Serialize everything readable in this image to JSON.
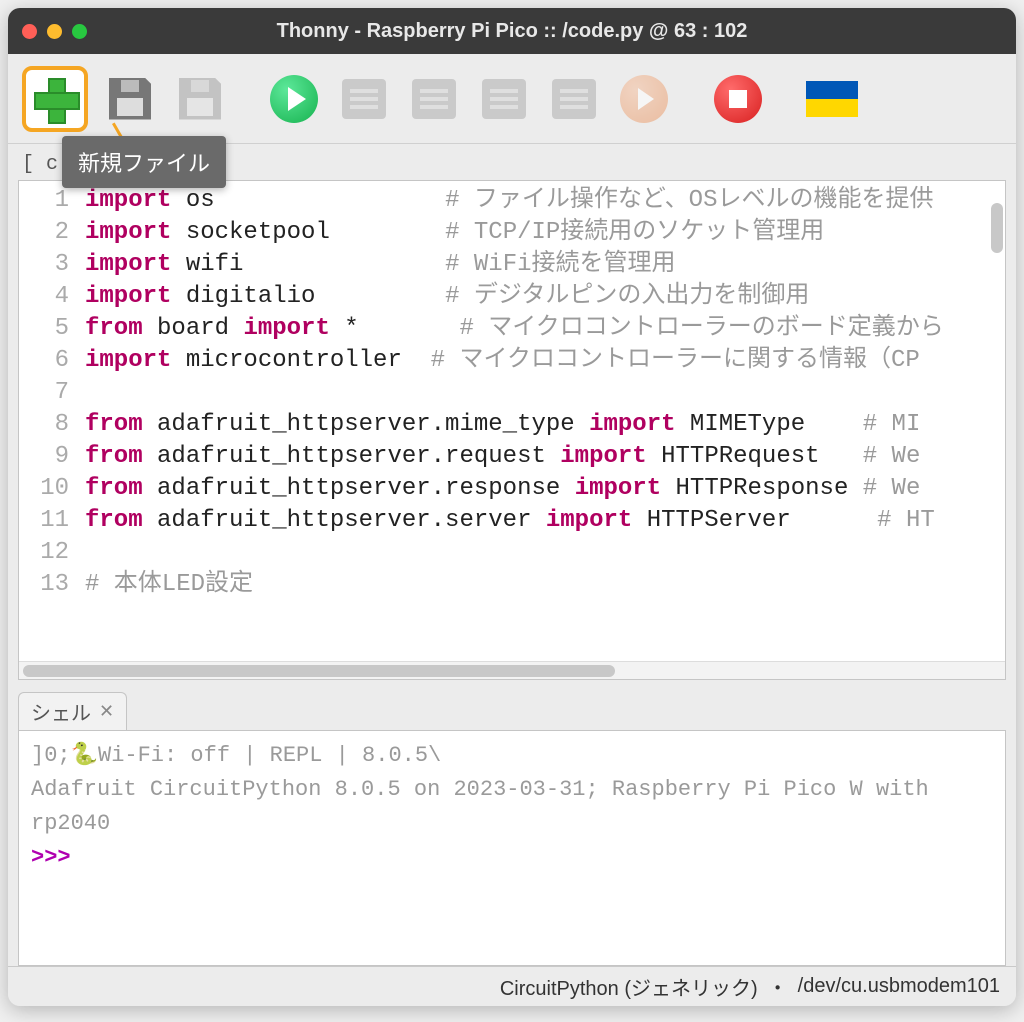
{
  "window": {
    "title": "Thonny  -  Raspberry Pi Pico :: /code.py  @  63 : 102"
  },
  "toolbar": {
    "tooltip_new_file": "新規ファイル"
  },
  "editor": {
    "tab_prefix": "[ c",
    "lines": [
      {
        "n": "1",
        "pre": "",
        "kw": "import",
        "mid": " os                ",
        "cm": "# ファイル操作など、OSレベルの機能を提供"
      },
      {
        "n": "2",
        "pre": "",
        "kw": "import",
        "mid": " socketpool        ",
        "cm": "# TCP/IP接続用のソケット管理用"
      },
      {
        "n": "3",
        "pre": "",
        "kw": "import",
        "mid": " wifi              ",
        "cm": "# WiFi接続を管理用"
      },
      {
        "n": "4",
        "pre": "",
        "kw": "import",
        "mid": " digitalio         ",
        "cm": "# デジタルピンの入出力を制御用"
      },
      {
        "n": "5",
        "pre": "",
        "kw": "from",
        "mid": " board ",
        "kw2": "import",
        "tail": " *       ",
        "cm": "# マイクロコントローラーのボード定義から"
      },
      {
        "n": "6",
        "pre": "",
        "kw": "import",
        "mid": " microcontroller  ",
        "cm": "# マイクロコントローラーに関する情報（CP"
      },
      {
        "n": "7",
        "pre": "",
        "kw": "",
        "mid": "",
        "cm": ""
      },
      {
        "n": "8",
        "pre": "",
        "kw": "from",
        "mid": " adafruit_httpserver.mime_type ",
        "kw2": "import",
        "tail": " MIMEType    ",
        "cm": "# MI"
      },
      {
        "n": "9",
        "pre": "",
        "kw": "from",
        "mid": " adafruit_httpserver.request ",
        "kw2": "import",
        "tail": " HTTPRequest   ",
        "cm": "# We"
      },
      {
        "n": "10",
        "pre": "",
        "kw": "from",
        "mid": " adafruit_httpserver.response ",
        "kw2": "import",
        "tail": " HTTPResponse ",
        "cm": "# We"
      },
      {
        "n": "11",
        "pre": "",
        "kw": "from",
        "mid": " adafruit_httpserver.server ",
        "kw2": "import",
        "tail": " HTTPServer      ",
        "cm": "# HT"
      },
      {
        "n": "12",
        "pre": "",
        "kw": "",
        "mid": "",
        "cm": ""
      },
      {
        "n": "13",
        "pre": "",
        "kw": "",
        "mid": "",
        "cm": "# 本体LED設定"
      }
    ]
  },
  "shell": {
    "tab_label": "シェル",
    "line1": "]0;🐍Wi-Fi: off | REPL | 8.0.5\\",
    "line2": "Adafruit CircuitPython 8.0.5 on 2023-03-31; Raspberry Pi Pico W with rp2040",
    "prompt": ">>> "
  },
  "status": {
    "backend": "CircuitPython (ジェネリック)",
    "sep": "・",
    "port": "/dev/cu.usbmodem101"
  }
}
